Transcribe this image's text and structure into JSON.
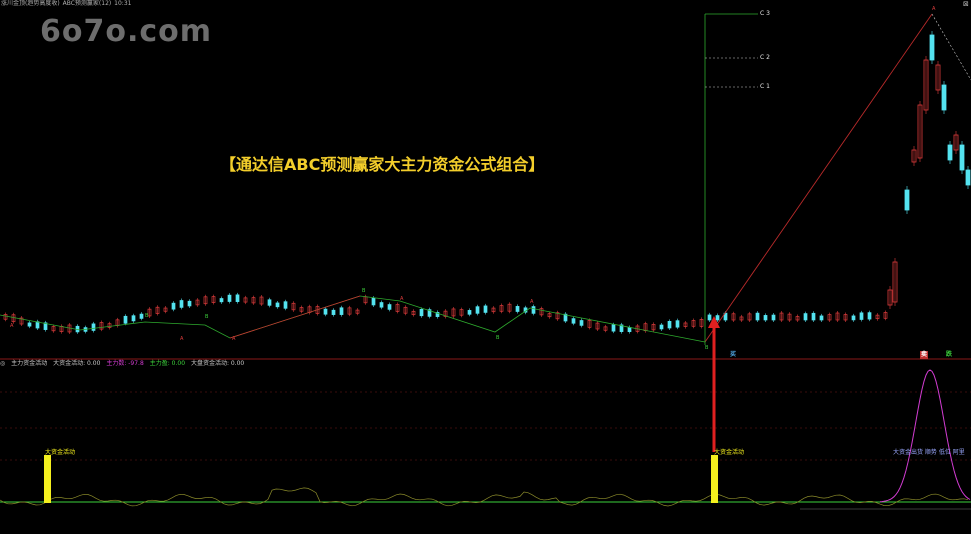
{
  "window": {
    "title_left": "涨川金顶(趋势高度收)",
    "indicator_name": "ABC预测赢家(12)",
    "time": "10:31",
    "corner_icon": "close-icon"
  },
  "watermark": "6o7o.com",
  "overlay_title": "【通达信ABC预测赢家大主力资金公式组合】",
  "price_panel": {
    "wave_labels": [
      "A",
      "B",
      "A",
      "B",
      "A",
      "B",
      "A",
      "B",
      "A",
      "B",
      "A"
    ],
    "c_levels": [
      "C 3",
      "C 2",
      "C 1"
    ],
    "bottom_tags": [
      "买",
      "卖",
      "跌"
    ]
  },
  "indicator_panel": {
    "items": [
      {
        "label": "主力资金活动",
        "color": "#c8c8c8"
      },
      {
        "label": "大资金活动: 0.00",
        "color": "#c8c8c8"
      },
      {
        "label": "主力数: -97.8",
        "color": "#d23cd2"
      },
      {
        "label": "主力盈: 0.00",
        "color": "#3cd23c"
      },
      {
        "label": "大盘资金活动: 0.00",
        "color": "#c8c8c8"
      }
    ],
    "bar_labels": [
      "大资金活动",
      "大资金活动"
    ],
    "right_note": "大资金出货 顺势 低位 阿里"
  },
  "colors": {
    "background": "#000000",
    "up_candle": "#e03c3c",
    "down_candle": "#54e3f0",
    "volume_bar": "#f5f01e",
    "ma_line": "#d23cd2",
    "zero_line": "#3cd23c",
    "arrow": "#e02020"
  }
}
